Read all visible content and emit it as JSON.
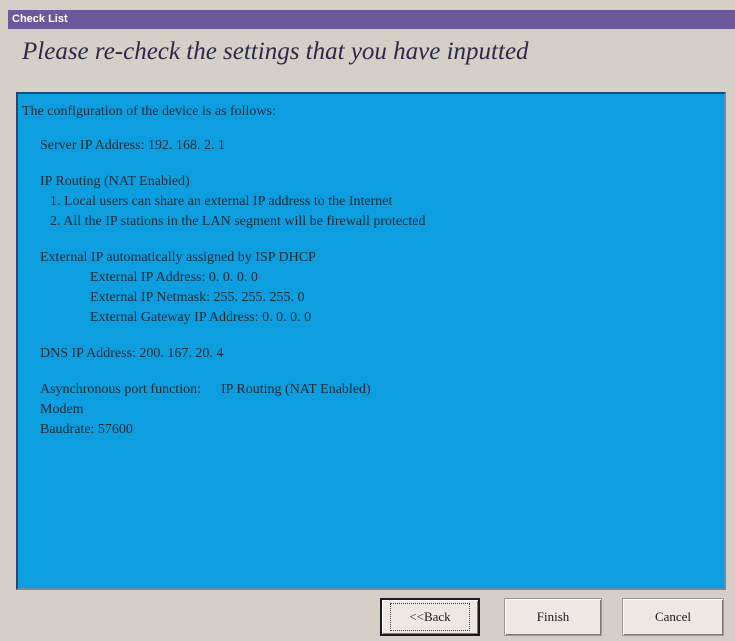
{
  "window": {
    "title": "Check List"
  },
  "header": {
    "headline": "Please re-check the settings that you have inputted"
  },
  "config": {
    "intro": "The configuration of the device is as follows:",
    "server_ip": "Server IP Address: 192. 168. 2. 1",
    "ip_routing": "IP Routing (NAT Enabled)",
    "routing_items": [
      "1. Local users can share an external IP address to the Internet",
      "2. All the IP stations in the LAN segment will be firewall protected"
    ],
    "external_ip_heading": "External IP automatically assigned by ISP DHCP",
    "external_items": [
      "External IP Address: 0. 0. 0. 0",
      "External IP Netmask: 255. 255. 255. 0",
      "External Gateway IP Address: 0. 0. 0. 0"
    ],
    "dns_ip": "DNS IP Address: 200. 167. 20. 4",
    "async_label": "Asynchronous port function:",
    "async_value": "IP Routing (NAT Enabled)",
    "modem": "Modem",
    "baudrate": "Baudrate: 57600"
  },
  "buttons": {
    "back": "<<Back",
    "finish": "Finish",
    "cancel": "Cancel"
  }
}
